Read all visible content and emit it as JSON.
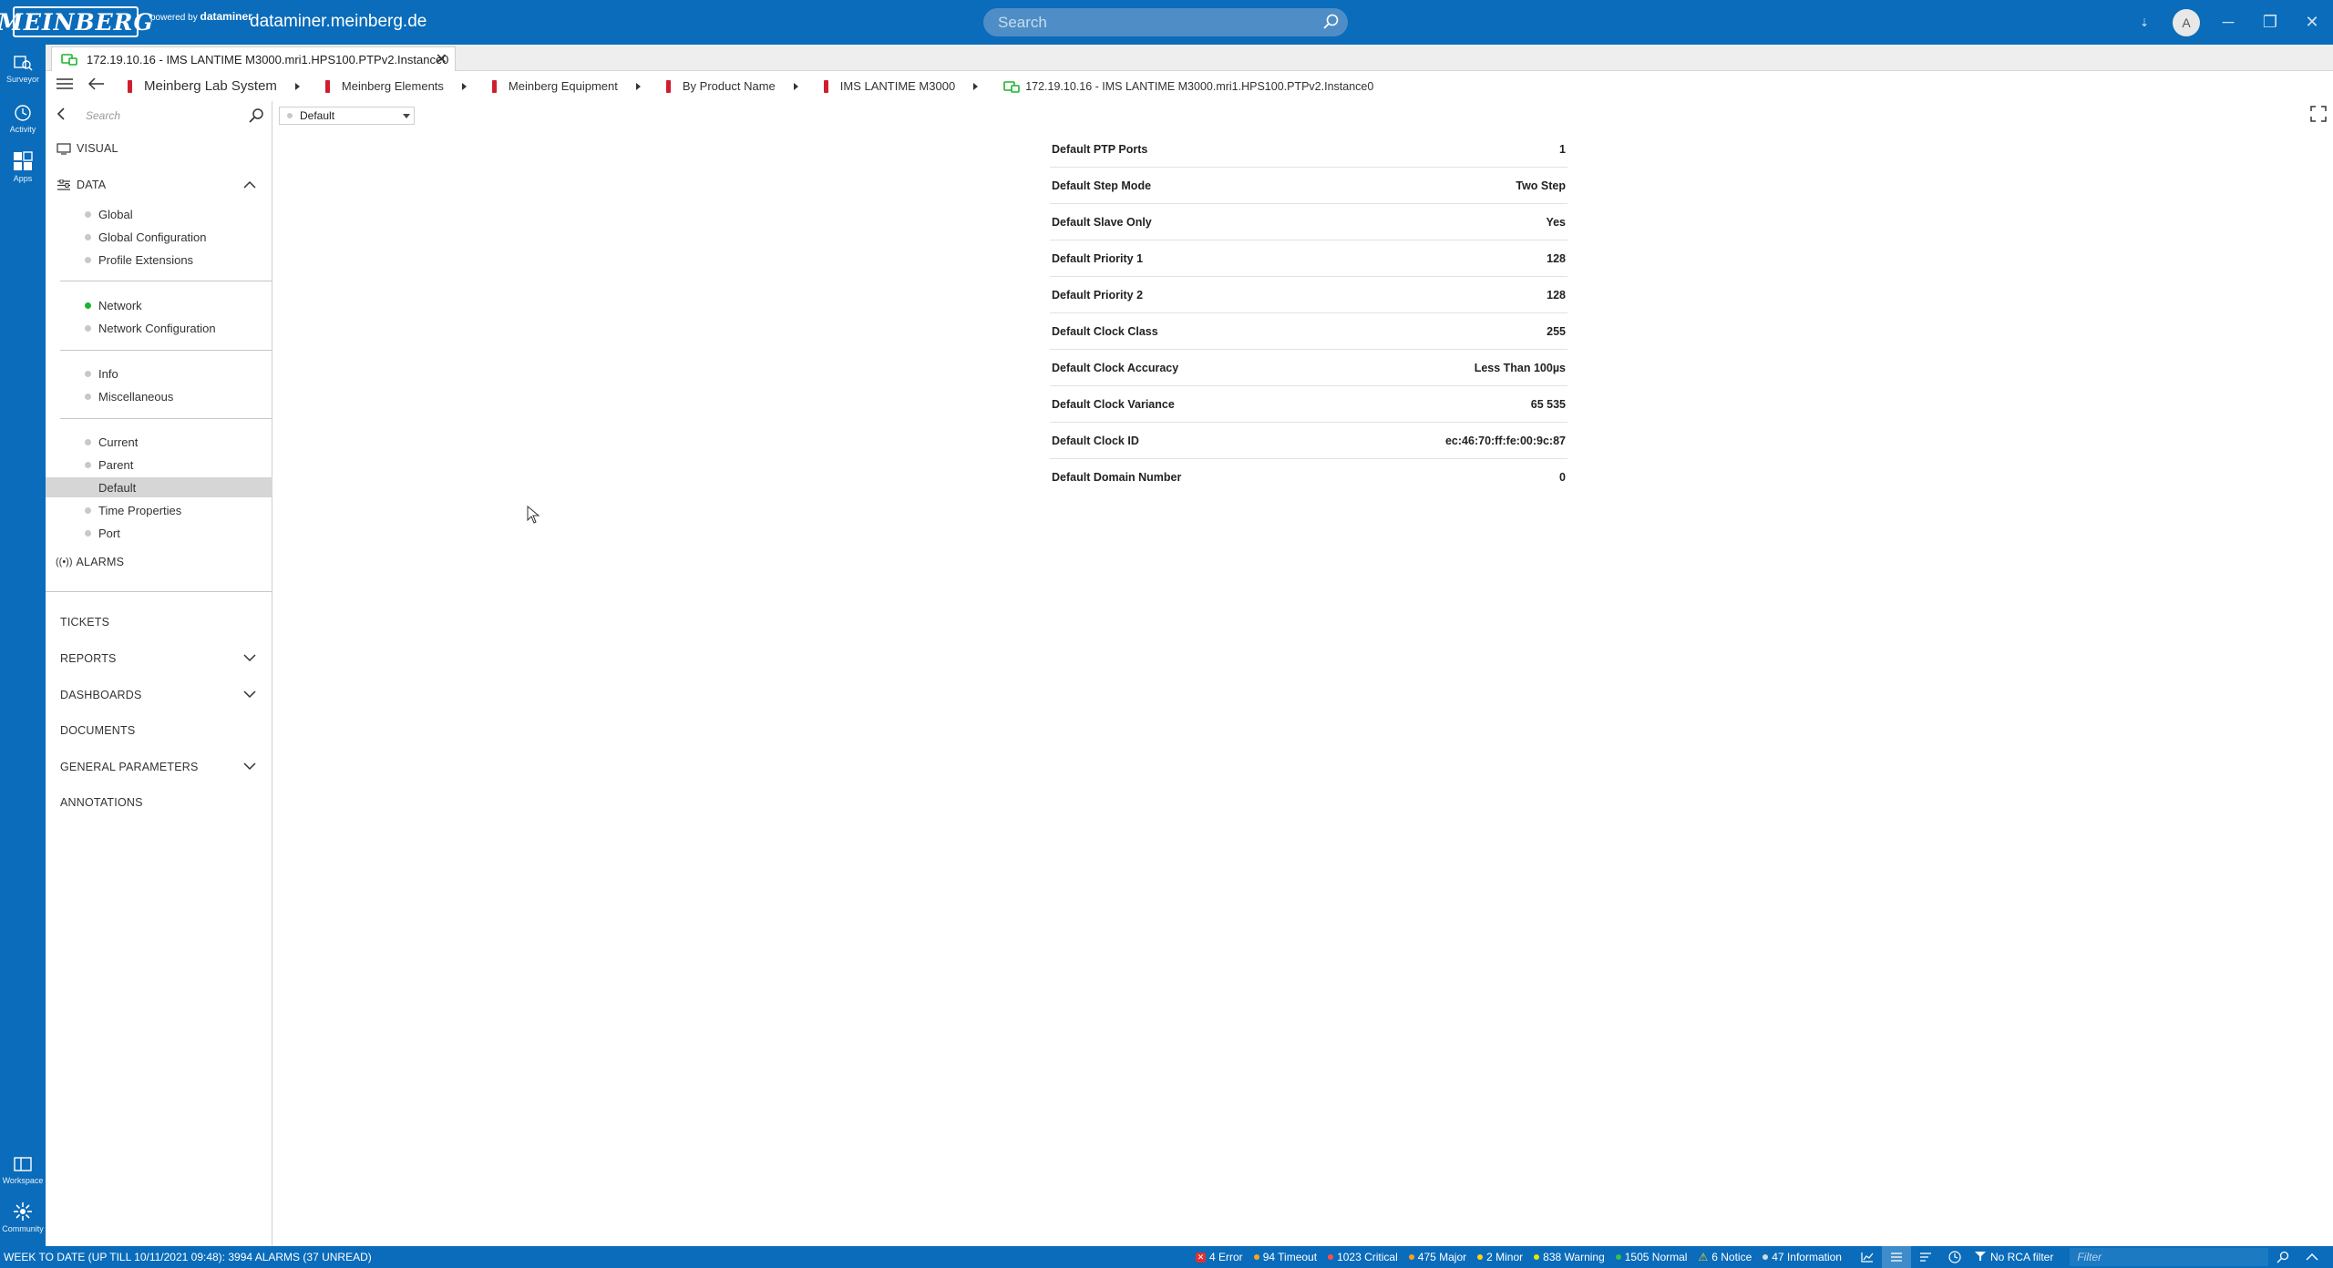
{
  "app": {
    "logo_text": "MEINBERG",
    "powered_by": "powered by",
    "powered_brand": "dataminer",
    "hostname": "dataminer.meinberg.de",
    "search_placeholder": "Search",
    "user_initial": "A"
  },
  "rail": {
    "surveyor": "Surveyor",
    "activity": "Activity",
    "apps": "Apps",
    "workspace": "Workspace",
    "community": "Community"
  },
  "tab": {
    "title": "172.19.10.16 - IMS LANTIME M3000.mri1.HPS100.PTPv2.Instance0"
  },
  "breadcrumb": [
    "Meinberg Lab System",
    "Meinberg Elements",
    "Meinberg Equipment",
    "By Product Name",
    "IMS LANTIME M3000",
    "172.19.10.16 - IMS LANTIME M3000.mri1.HPS100.PTPv2.Instance0"
  ],
  "panel": {
    "search_placeholder": "Search",
    "visual": "VISUAL",
    "data": "DATA",
    "groups": [
      [
        "Global",
        "Global Configuration",
        "Profile Extensions"
      ],
      [
        "Network",
        "Network Configuration"
      ],
      [
        "Info",
        "Miscellaneous"
      ],
      [
        "Current",
        "Parent",
        "Default",
        "Time Properties",
        "Port"
      ]
    ],
    "alarms": "ALARMS",
    "tickets": "TICKETS",
    "reports": "REPORTS",
    "dashboards": "DASHBOARDS",
    "documents": "DOCUMENTS",
    "general_parameters": "GENERAL PARAMETERS",
    "annotations": "ANNOTATIONS"
  },
  "main": {
    "dropdown_value": "Default",
    "parameters": [
      {
        "label": "Default PTP Ports",
        "value": "1"
      },
      {
        "label": "Default Step Mode",
        "value": "Two Step"
      },
      {
        "label": "Default Slave Only",
        "value": "Yes"
      },
      {
        "label": "Default Priority 1",
        "value": "128"
      },
      {
        "label": "Default Priority 2",
        "value": "128"
      },
      {
        "label": "Default Clock Class",
        "value": "255"
      },
      {
        "label": "Default Clock Accuracy",
        "value": "Less Than 100µs"
      },
      {
        "label": "Default Clock Variance",
        "value": "65 535"
      },
      {
        "label": "Default Clock ID",
        "value": "ec:46:70:ff:fe:00:9c:87"
      },
      {
        "label": "Default Domain Number",
        "value": "0"
      }
    ]
  },
  "status": {
    "left": "WEEK TO DATE (UP TILL 10/11/2021 09:48): 3994 ALARMS (37 UNREAD)",
    "counts": [
      {
        "text": "4 Error",
        "color": "#e0312f"
      },
      {
        "text": "94 Timeout",
        "color": "#f5a623"
      },
      {
        "text": "1023 Critical",
        "color": "#ff4d4d"
      },
      {
        "text": "475 Major",
        "color": "#ff9f1a"
      },
      {
        "text": "2 Minor",
        "color": "#ffd11a"
      },
      {
        "text": "838 Warning",
        "color": "#e6e600"
      },
      {
        "text": "1505 Normal",
        "color": "#36c24a"
      },
      {
        "text": "6 Notice",
        "color": "#ffd11a"
      },
      {
        "text": "47 Information",
        "color": "#d9d9d9"
      }
    ],
    "rca": "No RCA filter",
    "filter_placeholder": "Filter"
  },
  "colors": {
    "brand": "#0a6cba",
    "breadcrumb_marker": "#d01e2f",
    "online": "#1fb32e"
  }
}
